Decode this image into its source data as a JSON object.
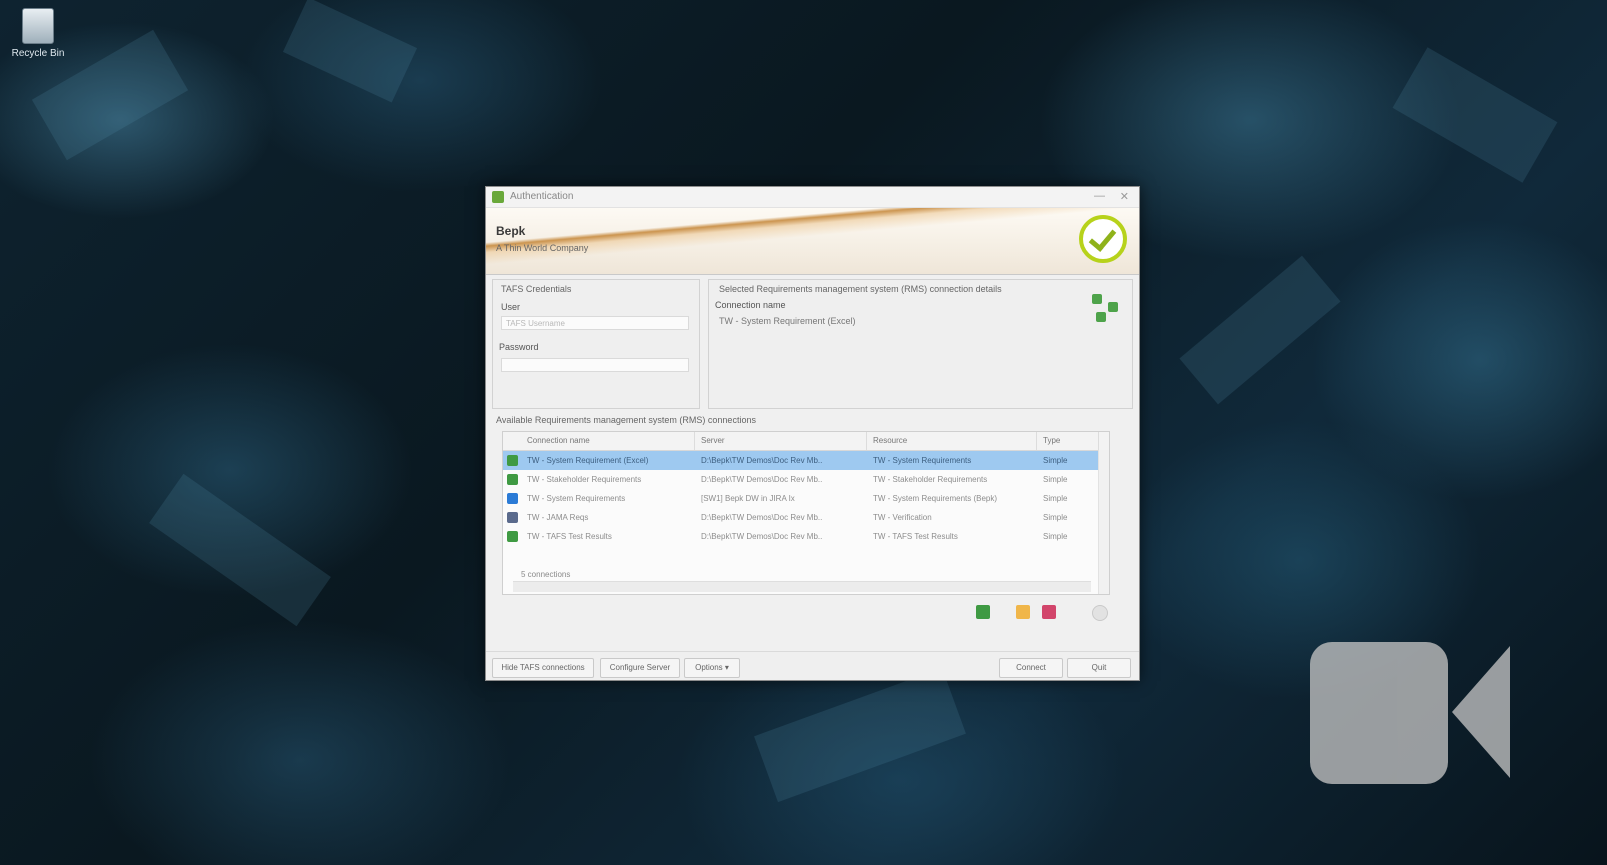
{
  "desktop": {
    "recycle_bin_label": "Recycle Bin"
  },
  "window": {
    "title": "Authentication",
    "minimize_glyph": "—",
    "close_glyph": "✕"
  },
  "banner": {
    "brand": "Bepk",
    "subtitle": "A Thin World Company",
    "status_icon": "success-check-icon"
  },
  "login": {
    "group_title": "TAFS Credentials",
    "user_label": "User",
    "user_placeholder": "TAFS Username",
    "password_label": "Password"
  },
  "connection": {
    "group_title": "Selected Requirements management system (RMS) connection details",
    "name_label": "Connection name",
    "name_value": "TW - System Requirement (Excel)"
  },
  "connections_list": {
    "title": "Available Requirements management system (RMS) connections",
    "columns": [
      "Connection name",
      "Server",
      "Resource",
      "Type"
    ],
    "rows": [
      {
        "name": "TW - System Requirement (Excel)",
        "server": "D:\\Bepk\\TW Demos\\Doc Rev Mb..",
        "resource": "TW - System Requirements",
        "type": "Simple",
        "icon_color": "#3f9a43",
        "icon": "excel-icon",
        "selected": true
      },
      {
        "name": "TW - Stakeholder Requirements",
        "server": "D:\\Bepk\\TW Demos\\Doc Rev Mb..",
        "resource": "TW - Stakeholder Requirements",
        "type": "Simple",
        "icon_color": "#3f9a43",
        "icon": "excel-icon",
        "selected": false
      },
      {
        "name": "TW - System Requirements",
        "server": "[SW1] Bepk DW in JIRA Ix",
        "resource": "TW - System Requirements (Bepk)",
        "type": "Simple",
        "icon_color": "#2b7bd6",
        "icon": "jira-icon",
        "selected": false
      },
      {
        "name": "TW - JAMA Reqs",
        "server": "D:\\Bepk\\TW Demos\\Doc Rev Mb..",
        "resource": "TW - Verification",
        "type": "Simple",
        "icon_color": "#5a6a8c",
        "icon": "jama-icon",
        "selected": false
      },
      {
        "name": "TW - TAFS Test Results",
        "server": "D:\\Bepk\\TW Demos\\Doc Rev Mb..",
        "resource": "TW - TAFS Test Results",
        "type": "Simple",
        "icon_color": "#3f9a43",
        "icon": "excel-icon",
        "selected": false
      }
    ],
    "count_text": "5 connections"
  },
  "buttons": {
    "hide_tafs": "Hide TAFS connections",
    "configure": "Configure Server",
    "options": "Options ▾",
    "connect": "Connect",
    "quit": "Quit"
  },
  "colors": {
    "selection": "#9ec9f0",
    "success": "#b7d21b"
  }
}
